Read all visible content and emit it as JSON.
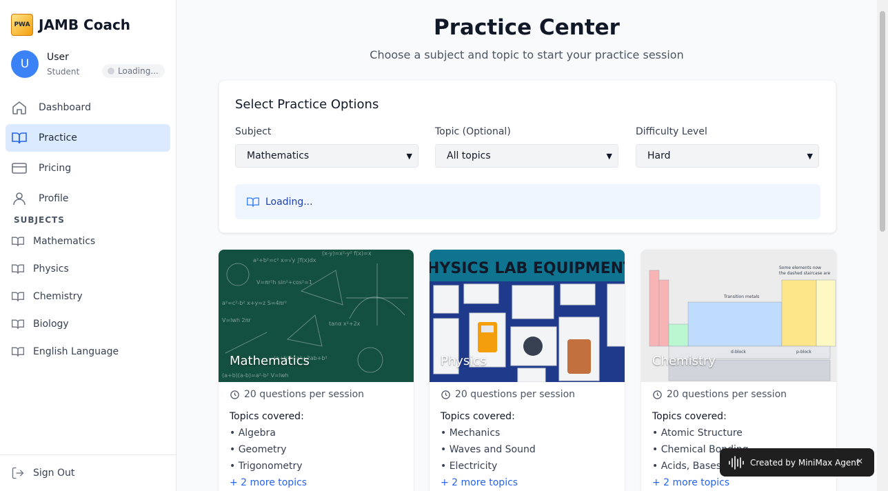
{
  "app": {
    "brand_name": "JAMB Coach",
    "logo_text": "PWA"
  },
  "user": {
    "initial": "U",
    "name": "User",
    "role": "Student",
    "status": "Loading..."
  },
  "nav": {
    "items": [
      {
        "label": "Dashboard",
        "icon": "home-icon"
      },
      {
        "label": "Practice",
        "icon": "book-icon"
      },
      {
        "label": "Pricing",
        "icon": "credit-card-icon"
      },
      {
        "label": "Profile",
        "icon": "user-icon"
      }
    ],
    "active": "Practice"
  },
  "subjects_section": {
    "title": "SUBJECTS",
    "items": [
      "Mathematics",
      "Physics",
      "Chemistry",
      "Biology",
      "English Language"
    ]
  },
  "sign_out": "Sign Out",
  "page": {
    "title": "Practice Center",
    "subtitle": "Choose a subject and topic to start your practice session"
  },
  "options": {
    "title": "Select Practice Options",
    "subject_label": "Subject",
    "subject_value": "Mathematics",
    "topic_label": "Topic (Optional)",
    "topic_value": "All topics",
    "difficulty_label": "Difficulty Level",
    "difficulty_value": "Hard",
    "info_text": "Loading..."
  },
  "cards": [
    {
      "name": "Mathematics",
      "meta": "20 questions per session",
      "topics_title": "Topics covered:",
      "topics": [
        "• Algebra",
        "• Geometry",
        "• Trigonometry"
      ],
      "more": "+ 2 more topics"
    },
    {
      "name": "Physics",
      "meta": "20 questions per session",
      "topics_title": "Topics covered:",
      "topics": [
        "• Mechanics",
        "• Waves and Sound",
        "• Electricity"
      ],
      "more": "+ 2 more topics",
      "banner": "HYSICS LAB EQUIPMENT"
    },
    {
      "name": "Chemistry",
      "meta": "20 questions per session",
      "topics_title": "Topics covered:",
      "topics": [
        "• Atomic Structure",
        "• Chemical Bonding",
        "• Acids, Bases and Salts"
      ],
      "more": "+ 2 more topics"
    }
  ],
  "toast": {
    "text": "Created by MiniMax Agent",
    "close": "✕"
  },
  "colors": {
    "accent": "#3b82f6",
    "active_bg": "#dbeafe",
    "link": "#2563eb"
  }
}
